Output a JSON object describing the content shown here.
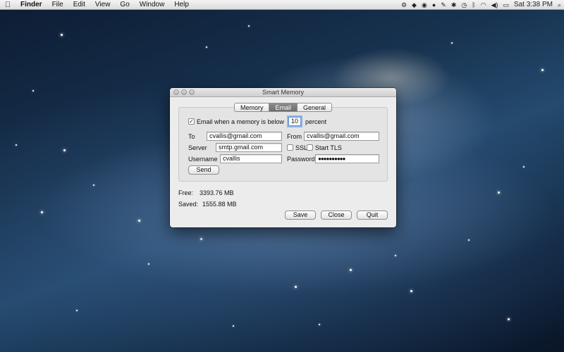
{
  "menubar": {
    "apple_icon": "apple-logo",
    "items": [
      "Finder",
      "File",
      "Edit",
      "View",
      "Go",
      "Window",
      "Help"
    ],
    "clock": "Sat 3:38 PM",
    "tray_icons": [
      "gear-icon",
      "dropbox-icon",
      "chrome-icon",
      "app-icon",
      "tool-icon",
      "settings-icon",
      "time-machine-icon",
      "bluetooth-icon",
      "wifi-icon",
      "volume-icon",
      "battery-icon",
      "search-icon"
    ]
  },
  "window": {
    "title": "Smart Memory",
    "tabs": [
      "Memory",
      "Email",
      "General"
    ],
    "active_tab": "Email",
    "email": {
      "enable_label": "Email when a memory is below",
      "enabled": true,
      "threshold": "10",
      "threshold_unit": "percent",
      "to_label": "To",
      "to_value": "cvallis@gmail.com",
      "from_label": "From",
      "from_value": "cvallis@gmail.com",
      "server_label": "Server",
      "server_value": "smtp.gmail.com",
      "ssl_label": "SSL",
      "ssl_checked": false,
      "starttls_label": "Start TLS",
      "starttls_checked": false,
      "username_label": "Username",
      "username_value": "cvallis",
      "password_label": "Password",
      "password_value": "●●●●●●●●●●",
      "send_label": "Send"
    },
    "free_label": "Free:",
    "free_value": "3393.76 MB",
    "saved_label": "Saved:",
    "saved_value": "1555.88 MB",
    "buttons": {
      "save": "Save",
      "close": "Close",
      "quit": "Quit"
    }
  }
}
